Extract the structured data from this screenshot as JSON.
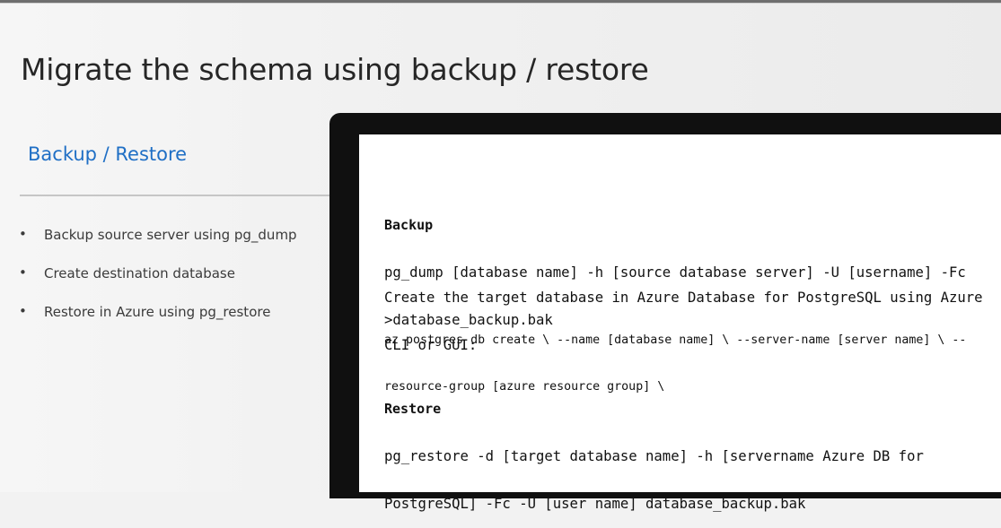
{
  "slide": {
    "title": "Migrate the schema using backup / restore",
    "section_heading": "Backup / Restore",
    "bullets": [
      {
        "text": "Backup source server using pg_dump"
      },
      {
        "text": "Create destination database"
      },
      {
        "text": "Restore in Azure using pg_restore"
      }
    ]
  },
  "screen": {
    "backup": {
      "label": "Backup",
      "line1": "pg_dump [database name] -h [source database server] -U [username] -Fc",
      "line2": ">database_backup.bak"
    },
    "create": {
      "line1": "Create the target database in Azure Database for PostgreSQL using Azure",
      "line2": "CLI or GUI:"
    },
    "az_command": {
      "line1": "az postgres db create \\ --name [database name] \\ --server-name [server name] \\ --",
      "line2": "resource-group [azure resource group] \\"
    },
    "restore": {
      "label": "Restore",
      "line1": "pg_restore -d [target database name] -h [servername Azure DB for",
      "line2": "PostgreSQL] -Fc -U [user name] database_backup.bak"
    }
  },
  "colors": {
    "accent": "#1f6fc5",
    "title_text": "#262626",
    "body_text": "#3b3b3b",
    "monitor_frame": "#101010",
    "screen_bg": "#ffffff"
  },
  "icons": {
    "bullet": "•"
  }
}
